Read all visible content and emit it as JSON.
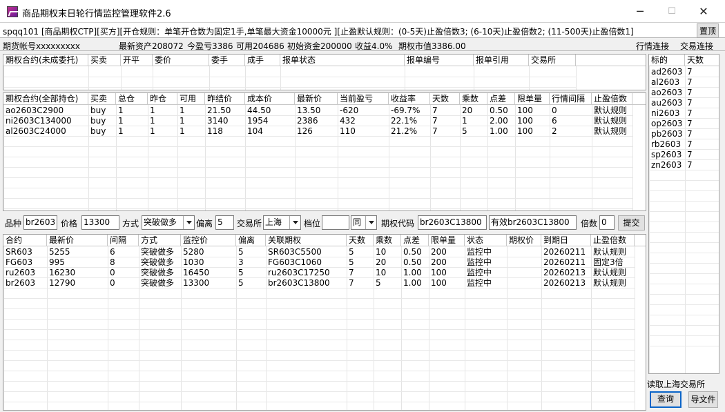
{
  "window": {
    "title": "商品期权末日轮行情监控管理软件2.6",
    "minimize": "─",
    "maximize": "☐",
    "close": "✕"
  },
  "info": {
    "text": "spqq101 [商品期权CTP][买方][开仓规则：单笔开仓数为固定1手,单笔最大资金10000元 ][止盈默认规则：(0-5天)止盈倍数3; (6-10天)止盈倍数2; (11-500天)止盈倍数1]",
    "top_button": "置顶"
  },
  "status": {
    "account": "期货帐号xxxxxxxxx",
    "assets": "最新资产208072",
    "today_pnl": "今盈亏3386",
    "available": "可用204686",
    "initial": "初始资金200000",
    "return": "收益4.0%",
    "option_value": "期权市值3386.00",
    "quote_link": "行情连接",
    "trade_link": "交易连接"
  },
  "pending": {
    "headers": [
      "期权合约(未成委托)",
      "买卖",
      "开平",
      "委价",
      "委手",
      "成手",
      "报单状态",
      "报单编号",
      "报单引用",
      "交易所"
    ]
  },
  "positions": {
    "headers": [
      "期权合约(全部持仓)",
      "买卖",
      "总仓",
      "昨仓",
      "可用",
      "昨结价",
      "成本价",
      "最新价",
      "当前盈亏",
      "收益率",
      "天数",
      "乘数",
      "点差",
      "限单量",
      "行情间隔",
      "止盈倍数"
    ],
    "rows": [
      [
        "ao2603C2900",
        "buy",
        "1",
        "1",
        "1",
        "21.50",
        "44.50",
        "13.50",
        "-620",
        "-69.7%",
        "7",
        "20",
        "0.50",
        "100",
        "0",
        "默认规则"
      ],
      [
        "ni2603C134000",
        "buy",
        "1",
        "1",
        "1",
        "3140",
        "1954",
        "2386",
        "432",
        "22.1%",
        "7",
        "1",
        "2.00",
        "100",
        "6",
        "默认规则"
      ],
      [
        "al2603C24000",
        "buy",
        "1",
        "1",
        "1",
        "118",
        "104",
        "126",
        "110",
        "21.2%",
        "7",
        "5",
        "1.00",
        "100",
        "2",
        "默认规则"
      ]
    ]
  },
  "form": {
    "variety_label": "品种",
    "variety": "br2603",
    "price_label": "价格",
    "price": "13300",
    "mode_label": "方式",
    "mode": "突破做多",
    "offset_label": "偏离",
    "offset": "5",
    "exchange_label": "交易所",
    "exchange": "上海",
    "level_label": "档位",
    "level": "",
    "same": "同",
    "code_label": "期权代码",
    "code": "br2603C13800",
    "valid": "有效br2603C13800",
    "multiple_label": "倍数",
    "multiple": "0",
    "submit": "提交"
  },
  "monitor": {
    "headers": [
      "合约",
      "最新价",
      "间隔",
      "方式",
      "监控价",
      "偏离",
      "关联期权",
      "天数",
      "乘数",
      "点差",
      "限单量",
      "状态",
      "期权价",
      "到期日",
      "止盈倍数"
    ],
    "rows": [
      [
        "SR603",
        "5255",
        "6",
        "突破做多",
        "5280",
        "5",
        "SR603C5500",
        "5",
        "10",
        "0.50",
        "200",
        "监控中",
        "",
        "20260211",
        "默认规则"
      ],
      [
        "FG603",
        "995",
        "8",
        "突破做多",
        "1030",
        "3",
        "FG603C1060",
        "5",
        "20",
        "0.50",
        "200",
        "监控中",
        "",
        "20260211",
        "固定3倍"
      ],
      [
        "ru2603",
        "16230",
        "0",
        "突破做多",
        "16450",
        "5",
        "ru2603C17250",
        "7",
        "10",
        "1.00",
        "100",
        "监控中",
        "",
        "20260213",
        "默认规则"
      ],
      [
        "br2603",
        "12790",
        "0",
        "突破做多",
        "13300",
        "5",
        "br2603C13800",
        "7",
        "5",
        "1.00",
        "100",
        "监控中",
        "",
        "20260213",
        "默认规则"
      ]
    ]
  },
  "targets": {
    "headers": [
      "标的",
      "天数"
    ],
    "rows": [
      [
        "ad2603",
        "7"
      ],
      [
        "al2603",
        "7"
      ],
      [
        "ao2603",
        "7"
      ],
      [
        "au2603",
        "7"
      ],
      [
        "ni2603",
        "7"
      ],
      [
        "op2603",
        "7"
      ],
      [
        "pb2603",
        "7"
      ],
      [
        "rb2603",
        "7"
      ],
      [
        "sp2603",
        "7"
      ],
      [
        "zn2603",
        "7"
      ]
    ]
  },
  "bottom": {
    "status": "读取上海交易所",
    "query": "查询",
    "export": "导文件"
  }
}
